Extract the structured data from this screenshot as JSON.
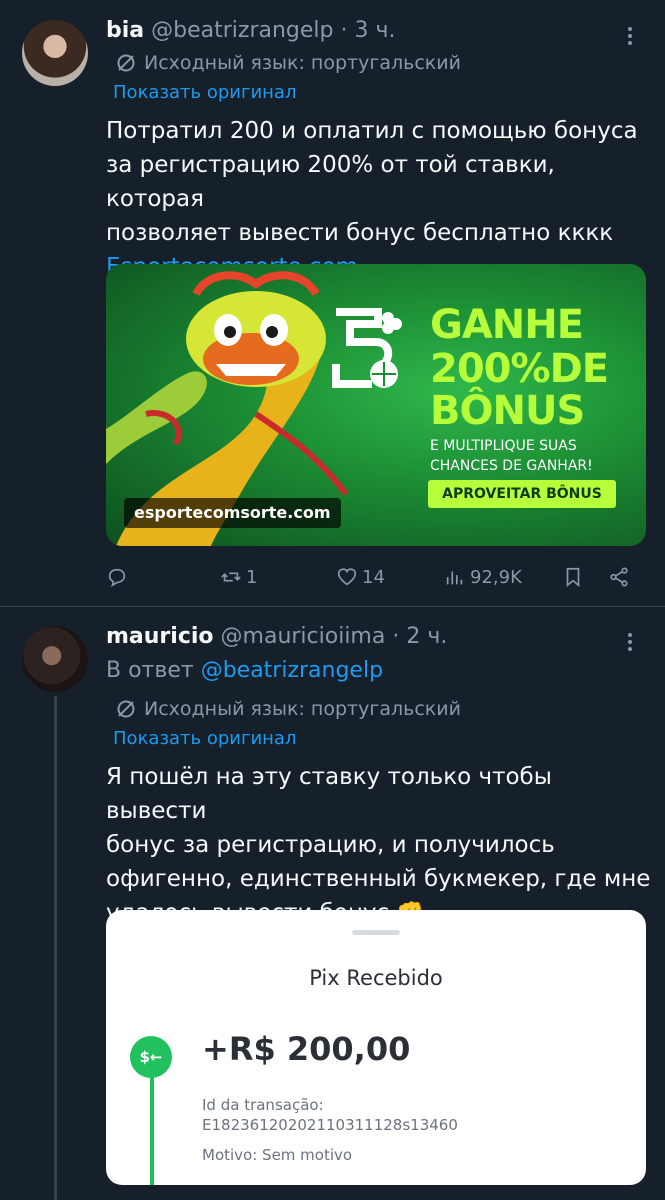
{
  "tweet1": {
    "name": "bia",
    "handle": "@beatrizrangelp",
    "time": "· 3 ч.",
    "translated_from": "Исходный язык: португальский",
    "show_original": "Показать оригинал",
    "text_lines": [
      "Потратил 200 и оплатил с помощью бонуса",
      "за регистрацию 200% от той ставки, которая",
      "позволяет вывести бонус бесплатно кккк"
    ],
    "link": "Esportecomsorte.com",
    "ad": {
      "headline_1": "GANHE",
      "headline_2": "200%DE",
      "headline_3": "BÔNUS",
      "sub_1": "E MULTIPLIQUE SUAS",
      "sub_2": "CHANCES DE GANHAR!",
      "cta": "APROVEITAR BÔNUS",
      "url": "esportecomsorte.com"
    },
    "actions": {
      "replies": "",
      "retweets": "1",
      "likes": "14",
      "views": "92,9K"
    }
  },
  "tweet2": {
    "name": "mauricio",
    "handle": "@mauricioiima",
    "time": "· 2 ч.",
    "reply_prefix": "В ответ",
    "reply_handle": "@beatrizrangelp",
    "translated_from": "Исходный язык: португальский",
    "show_original": "Показать оригинал",
    "text_lines": [
      "Я пошёл на эту ставку только чтобы вывести",
      "бонус за регистрацию, и получилось",
      "офигенно, единственный букмекер, где мне",
      "удалось вывести бонус 👊"
    ],
    "receipt": {
      "title": "Pix Recebido",
      "icon": "$←",
      "amount": "+R$ 200,00",
      "id_label": "Id da transação:",
      "id_value": "E18236120202110311128s13460",
      "reason": "Motivo: Sem motivo"
    }
  },
  "colors": {
    "background": "#15202b",
    "text": "#f7f9f9",
    "muted": "#8b98a5",
    "link": "#1d9bf0",
    "ad_accent": "#b6ff3a",
    "pix_green": "#21c25e"
  }
}
